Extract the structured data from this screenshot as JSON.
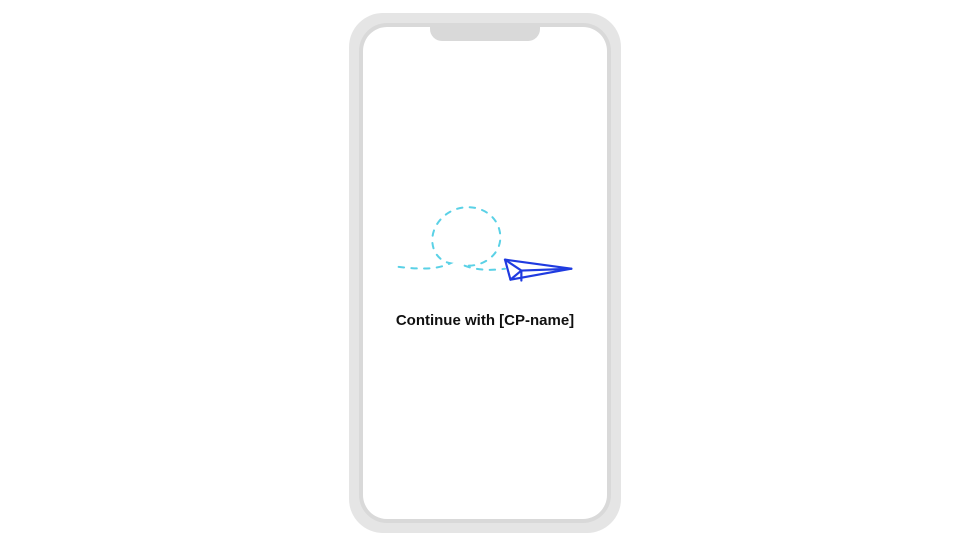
{
  "button": {
    "label": "Continue with [CP-name]"
  },
  "illustration": {
    "icon_name": "paper-plane-icon",
    "trail_color": "#5ad1e6",
    "plane_color": "#1f3be0"
  }
}
